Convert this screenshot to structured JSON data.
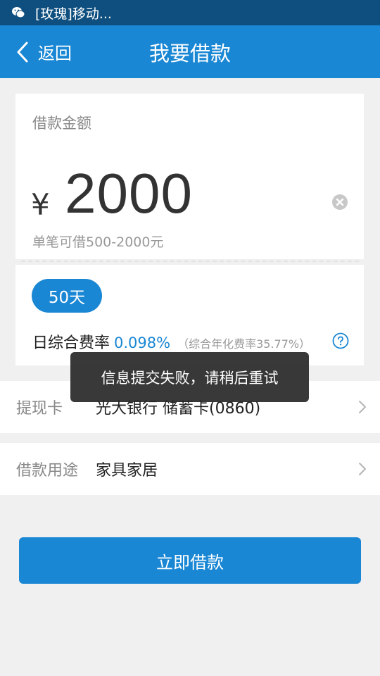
{
  "status_bar": {
    "notification_text": "[玫瑰]移动...",
    "app_icon": "wechat-icon"
  },
  "nav": {
    "back_label": "返回",
    "title": "我要借款"
  },
  "loan": {
    "amount_label": "借款金额",
    "currency_symbol": "¥",
    "amount": "2000",
    "amount_hint": "单笔可借500-2000元",
    "term": "50天",
    "daily_rate_label": "日综合费率",
    "daily_rate": "0.098%",
    "annual_rate_note": "（综合年化费率35.77%）"
  },
  "withdraw_card": {
    "label": "提现卡",
    "value": "光大银行 储蓄卡(0860)"
  },
  "loan_purpose": {
    "label": "借款用途",
    "value": "家具家居"
  },
  "submit": {
    "label": "立即借款"
  },
  "toast": {
    "message": "信息提交失败，请稍后重试"
  },
  "colors": {
    "primary": "#1a87d4",
    "status_bar": "#0f4f7f",
    "background": "#f0f0f0"
  }
}
